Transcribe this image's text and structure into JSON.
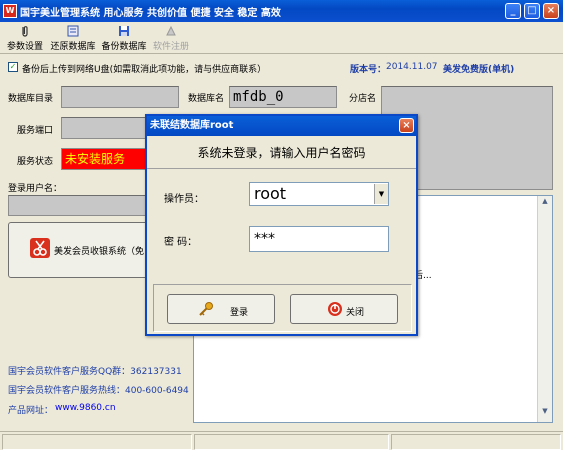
{
  "window": {
    "title": "国宇美业管理系统    用心服务    共创价值    便捷 安全 稳定 高效",
    "icon_text": "W",
    "min_label": "_",
    "max_label": "□",
    "close_label": "×"
  },
  "toolbar": {
    "items": [
      {
        "label": "参数设置",
        "icon": "paperclip-icon"
      },
      {
        "label": "还原数据库",
        "icon": "restore-db-icon"
      },
      {
        "label": "备份数据库",
        "icon": "save-disk-icon"
      },
      {
        "label": "软件注册",
        "icon": "register-icon",
        "disabled": true
      }
    ]
  },
  "backup": {
    "checkbox_label": "备份后上传到网络U盘(如需取消此项功能，请与供应商联系）",
    "checked_mark": "✓",
    "version_label": "版本号：",
    "version_value": "2014.11.07",
    "edition": "美发免费版(单机)"
  },
  "form": {
    "db_dir_label": "数据库目录",
    "db_name_label": "数据库名",
    "db_name_value": "mfdb_0",
    "branch_label": "分店名",
    "port_label": "服务端口",
    "status_label": "服务状态",
    "status_value": "未安装服务",
    "login_user_label": "登录用户名："
  },
  "main_button": {
    "label": "美发会员收银系统（免"
  },
  "right_panel": {
    "text": "后..."
  },
  "contact": {
    "qq": "国宇会员软件客户服务QQ群：362137331",
    "hotline": "国宇会员软件客户服务热线：400-600-6494",
    "site_label": "产品网址：",
    "site_url": "www.9860.cn"
  },
  "dialog": {
    "title": "未联结数据库root",
    "close_label": "×",
    "message": "系统未登录，请输入用户名密码",
    "operator_label": "操作员：",
    "operator_value": "root",
    "password_label": "密  码：",
    "password_value": "***",
    "login_label": "登录",
    "close_btn_label": "关闭"
  },
  "colors": {
    "title_blue": "#0348c3",
    "status_red": "#ff0000",
    "status_text": "#ffff00",
    "label_blue": "#1f3fa8"
  }
}
